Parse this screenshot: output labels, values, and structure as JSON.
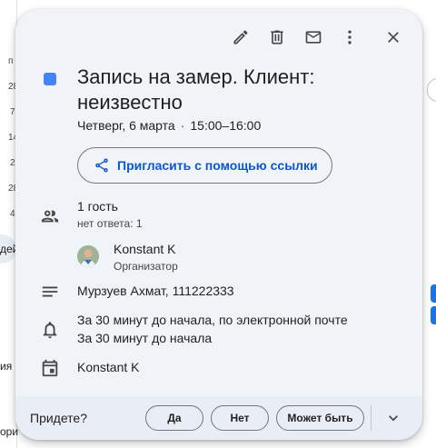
{
  "background": {
    "day_numbers": [
      "п",
      "28",
      "7",
      "14",
      "2",
      "28",
      "4"
    ],
    "left_text_1": "дей",
    "left_text_2": "ия",
    "left_text_3": "ори"
  },
  "toolbar": {
    "edit_icon": "pencil-icon",
    "delete_icon": "trash-icon",
    "email_icon": "mail-icon",
    "more_icon": "more-vert-icon",
    "close_icon": "close-icon"
  },
  "event": {
    "color": "#4285f4",
    "title": "Запись на замер. Клиент: неизвестно",
    "date": "Четверг, 6 марта",
    "separator": "·",
    "time": "15:00–16:00"
  },
  "invite": {
    "label": "Пригласить с помощью ссылки",
    "icon": "share-icon"
  },
  "guests": {
    "title": "1 гость",
    "subtitle": "нет ответа: 1",
    "organizer_name": "Konstant K",
    "organizer_role": "Организатор"
  },
  "description": "Мурзуев Ахмат, 111222333",
  "reminders": [
    "За 30 минут до начала, по электронной почте",
    "За 30 минут до начала"
  ],
  "calendar": {
    "name": "Konstant K"
  },
  "rsvp": {
    "question": "Придете?",
    "yes": "Да",
    "no": "Нет",
    "maybe": "Может быть",
    "more_icon": "chevron-down-icon"
  }
}
